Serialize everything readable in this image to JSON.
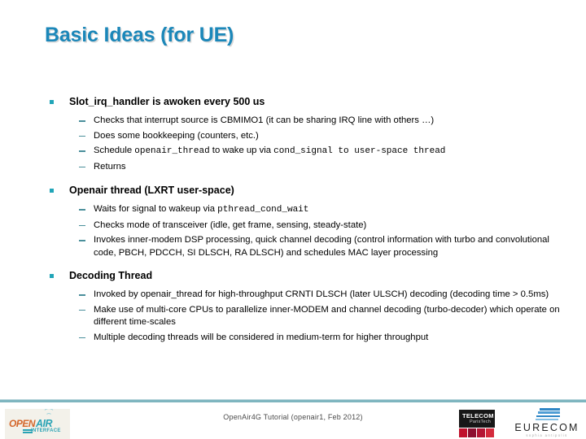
{
  "slide": {
    "title": "Basic Ideas (for UE)"
  },
  "sections": [
    {
      "heading": "Slot_irq_handler is awoken every 500 us",
      "items": [
        {
          "plain": "Checks that interrupt source is CBMIMO1 (it can be sharing IRQ line with others …)"
        },
        {
          "plain": "Does some bookkeeping (counters, etc.)"
        },
        {
          "pre": "Schedule ",
          "mono1": "openair_thread",
          "mid": " to wake up via ",
          "mono2": "cond_signal to user-space thread"
        },
        {
          "plain": "Returns"
        }
      ]
    },
    {
      "heading": "Openair thread (LXRT user-space)",
      "items": [
        {
          "pre": "Waits for signal to wakeup via ",
          "mono1": "pthread_cond_wait"
        },
        {
          "plain": "Checks mode of transceiver (idle, get frame, sensing, steady-state)"
        },
        {
          "plain": "Invokes inner-modem DSP processing, quick channel decoding (control information with turbo and convolutional code, PBCH, PDCCH, SI DLSCH, RA DLSCH) and schedules MAC layer processing"
        }
      ]
    },
    {
      "heading": "Decoding Thread",
      "items": [
        {
          "plain": "Invoked by openair_thread for high-throughput CRNTI DLSCH (later ULSCH) decoding (decoding time > 0.5ms)"
        },
        {
          "plain": "Make use of multi-core CPUs to parallelize inner-MODEM and channel decoding (turbo-decoder) which operate on different time-scales"
        },
        {
          "plain": "Multiple decoding threads will be considered in medium-term for higher throughput"
        }
      ]
    }
  ],
  "footer": {
    "center_text": "OpenAir4G Tutorial (openair1, Feb 2012)",
    "openair_logo": {
      "word1": "OPEN",
      "word2": "AIR",
      "word3": "INTERFACE"
    },
    "telecom_logo": {
      "line1": "TELECOM",
      "line2": "ParisTech"
    },
    "eurecom_logo": {
      "name": "EURECOM",
      "subtitle": "sophia antipolis"
    }
  },
  "colors": {
    "title_blue": "#1b87b9",
    "bullet_teal": "#21a5b8",
    "dash_teal": "#4a8f9b",
    "footer_rule": "#7eb5bf",
    "orange": "#d4662a",
    "eurecom_blue": "#2f86c5",
    "telecom_red": "#c0122d"
  }
}
